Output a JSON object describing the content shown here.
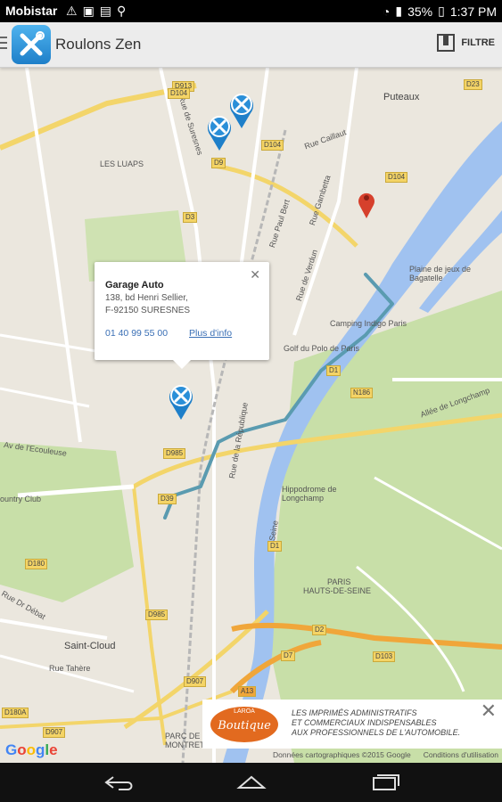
{
  "status_bar": {
    "carrier": "Mobistar",
    "battery": "35%",
    "time": "1:37 PM"
  },
  "app_bar": {
    "title": "Roulons Zen",
    "filter_label": "FILTRE"
  },
  "map": {
    "places": {
      "puteaux": "Puteaux",
      "les_lilas": "LES LUAPS",
      "camping": "Camping Indigo Paris",
      "golf": "Golf du Polo de Paris",
      "plaine": "Plaine de jeux de Bagatelle",
      "hippodrome": "Hippodrome de Longchamp",
      "saint_cloud": "Saint-Cloud",
      "parc": "PARC DE MONTRETOUT",
      "paris": "PARIS",
      "hauts": "HAUTS-DE-SEINE",
      "country": "ountry Club"
    },
    "streets": {
      "suresnes": "Rue de Suresnes",
      "verdun": "Rue de Verdun",
      "seine": "Seine",
      "longchamp": "Allée de Longchamp",
      "ecouleuse": "Av de l'Ecouleuse",
      "republique": "Rue de la République",
      "debat": "Rue Dr Débat",
      "tahere": "Rue Tahère",
      "gambetta": "Rue Gambetta",
      "paul_bert": "Rue Paul Bert",
      "caillaut": "Rue Caillaut"
    },
    "road_tags": [
      "D913",
      "D104",
      "D9",
      "D3",
      "D104",
      "D104",
      "D1",
      "N186",
      "D39",
      "D985",
      "D1",
      "D7",
      "D2",
      "D103",
      "A13",
      "D180",
      "D907",
      "D180A",
      "D985",
      "D907",
      "D23"
    ]
  },
  "popup": {
    "name": "Garage Auto",
    "address_line1": "138, bd Henri Sellier,",
    "address_line2": "F-92150 SURESNES",
    "phone": "01 40 99 55 00",
    "more_link": "Plus d'info"
  },
  "ad": {
    "brand_top": "LAROA",
    "brand": "Boutique",
    "line1": "LES IMPRIMÉS ADMINISTRATIFS",
    "line2": "ET COMMERCIAUX INDISPENSABLES",
    "line3": "AUX PROFESSIONNELS DE L'AUTOMOBILE."
  },
  "attribution": {
    "google": "Google",
    "data": "Données cartographiques ©2015 Google",
    "terms": "Conditions d'utilisation"
  },
  "colors": {
    "accent": "#2a8fd8",
    "route": "#5a9bb0",
    "river": "#a0c2f0",
    "park": "#c8dfa8",
    "marker_red": "#d6402c"
  }
}
